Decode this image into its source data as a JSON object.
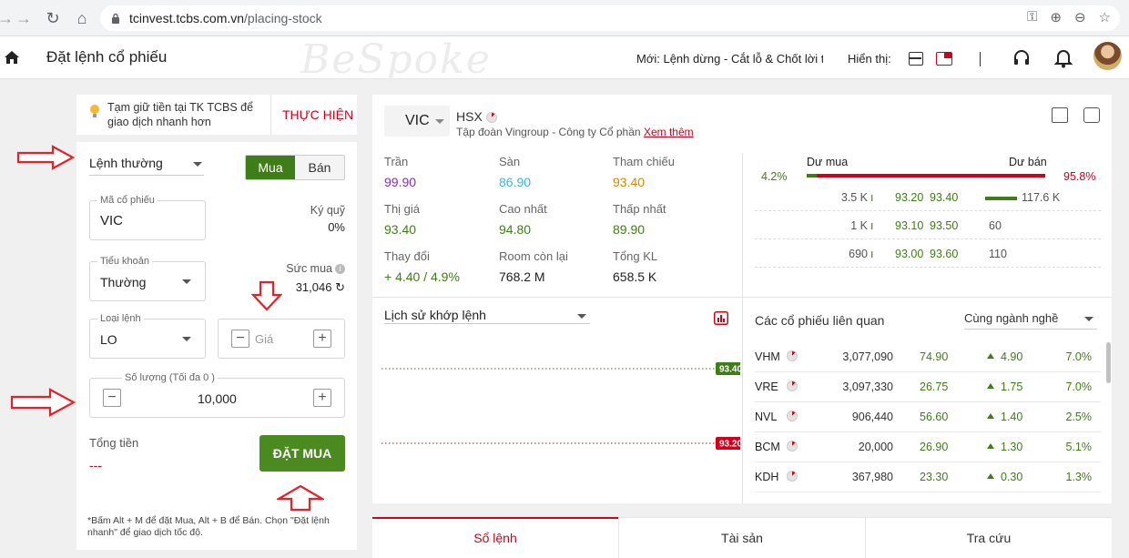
{
  "browser": {
    "url_host": "tcinvest.tcbs.com.vn",
    "url_path": "/placing-stock"
  },
  "header": {
    "title": "Đặt lệnh cổ phiếu",
    "watermark": "BeSpoke",
    "news": "Mới: Lệnh dừng - Cắt lỗ & Chốt lời tại",
    "display_label": "Hiển thị:"
  },
  "promo": {
    "text": "Tạm giữ tiền tại TK TCBS để giao dịch nhanh hơn",
    "action": "THỰC HIỆN"
  },
  "order": {
    "order_type": "Lệnh thường",
    "buy_label": "Mua",
    "sell_label": "Bán",
    "symbol_label": "Mã cổ phiếu",
    "symbol_value": "VIC",
    "margin_label": "Ký quỹ",
    "margin_value": "0%",
    "account_label": "Tiểu khoản",
    "account_value": "Thường",
    "buying_power_label": "Sức mua",
    "buying_power_value": "31,046",
    "order_kind_label": "Loại lệnh",
    "order_kind_value": "LO",
    "price_placeholder": "Giá",
    "qty_label": "Số lượng (Tối đa 0 )",
    "qty_value": "10,000",
    "total_label": "Tổng tiền",
    "total_value": "---",
    "place_button": "ĐẶT MUA",
    "hint": "*Bấm Alt + M để đặt Mua, Alt + B để Bán. Chọn \"Đặt lệnh nhanh\" để giao dịch tốc độ."
  },
  "stock": {
    "symbol": "VIC",
    "exchange": "HSX",
    "company": "Tập đoàn Vingroup - Công ty Cổ phần",
    "more_link": "Xem thêm",
    "stats": [
      {
        "label": "Trần",
        "value": "99.90",
        "color": "#8b2cc9"
      },
      {
        "label": "Sàn",
        "value": "86.90",
        "color": "#37b6e8"
      },
      {
        "label": "Tham chiếu",
        "value": "93.40",
        "color": "#d08b00"
      },
      {
        "label": "Thị giá",
        "value": "93.40",
        "color": "#3e7d18"
      },
      {
        "label": "Cao nhất",
        "value": "94.80",
        "color": "#3e7d18"
      },
      {
        "label": "Thấp nhất",
        "value": "89.90",
        "color": "#3e7d18"
      },
      {
        "label": "Thay đổi",
        "value": "+ 4.40 / 4.9%",
        "color": "#3e7d18"
      },
      {
        "label": "Room còn lại",
        "value": "768.2 M",
        "color": "#222222"
      },
      {
        "label": "Tổng KL",
        "value": "658.5 K",
        "color": "#222222"
      }
    ]
  },
  "depth": {
    "buy_label": "Dư mua",
    "sell_label": "Dư bán",
    "buy_pct": "4.2%",
    "sell_pct": "95.8%",
    "buy_share": 0.042,
    "rows": [
      {
        "bid_vol": "3.5 K",
        "bid": "93.20",
        "ask": "93.40",
        "ask_vol": "117.6 K",
        "ask_share": 1.0
      },
      {
        "bid_vol": "1 K",
        "bid": "93.10",
        "ask": "93.50",
        "ask_vol": "60",
        "ask_share": 0
      },
      {
        "bid_vol": "690",
        "bid": "93.00",
        "ask": "93.60",
        "ask_vol": "110",
        "ask_share": 0
      }
    ]
  },
  "history": {
    "label": "Lịch sử khớp lệnh",
    "price_high": "93.40",
    "price_low": "93.20"
  },
  "related": {
    "title": "Các cổ phiếu liên quan",
    "filter": "Cùng ngành nghề",
    "rows": [
      {
        "symbol": "VHM",
        "volume": "3,077,090",
        "price": "74.90",
        "change": "4.90",
        "pct": "7.0%"
      },
      {
        "symbol": "VRE",
        "volume": "3,097,330",
        "price": "26.75",
        "change": "1.75",
        "pct": "7.0%"
      },
      {
        "symbol": "NVL",
        "volume": "906,440",
        "price": "56.60",
        "change": "1.40",
        "pct": "2.5%"
      },
      {
        "symbol": "BCM",
        "volume": "20,000",
        "price": "26.90",
        "change": "1.30",
        "pct": "5.1%"
      },
      {
        "symbol": "KDH",
        "volume": "367,980",
        "price": "23.30",
        "change": "0.30",
        "pct": "1.3%"
      }
    ]
  },
  "tabs": [
    "Sổ lệnh",
    "Tài sản",
    "Tra cứu"
  ],
  "colors": {
    "accent_red": "#d0021b",
    "accent_green": "#3e7d18",
    "annotation_red": "#e8202a"
  }
}
